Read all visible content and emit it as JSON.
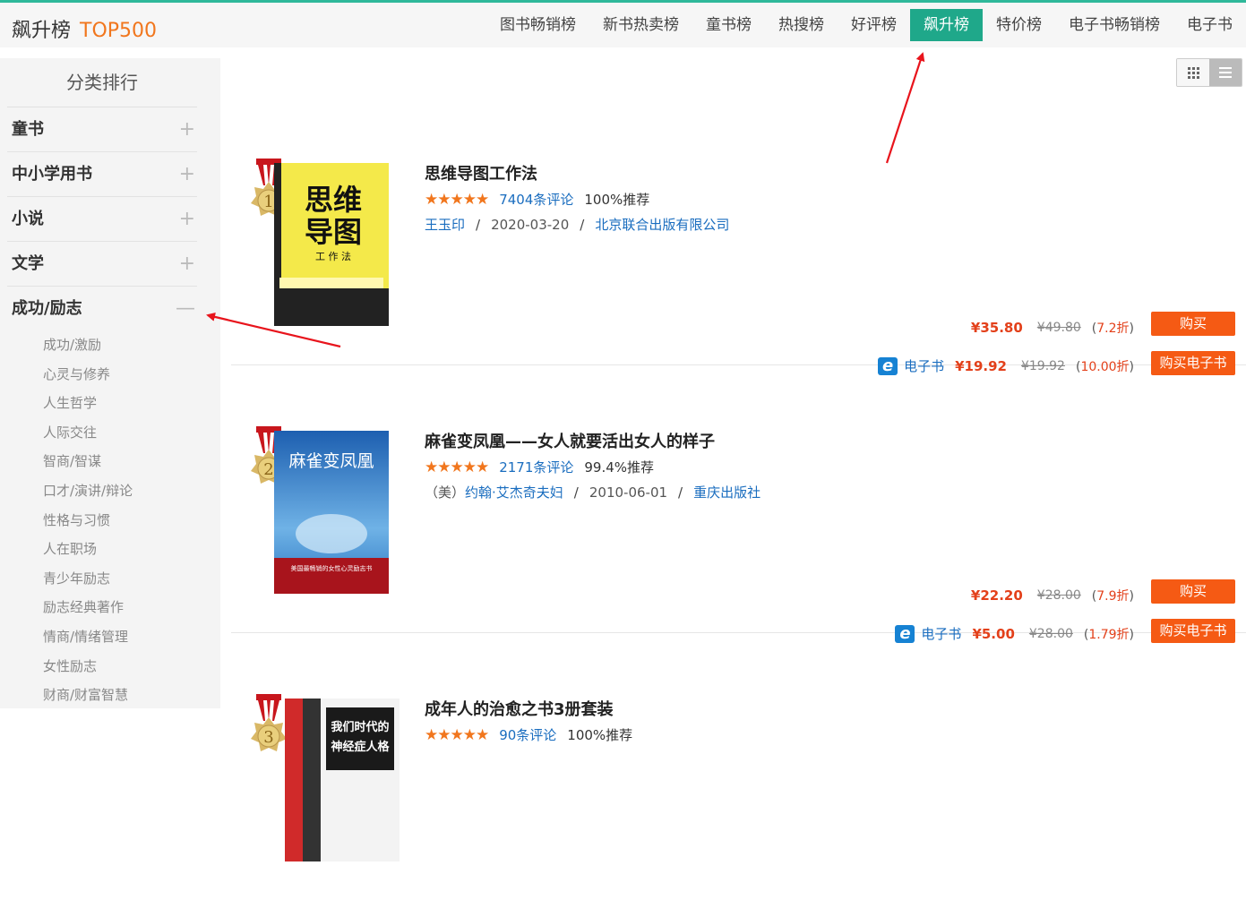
{
  "header": {
    "title": "飙升榜",
    "subtitle": "TOP500",
    "tabs": [
      "图书畅销榜",
      "新书热卖榜",
      "童书榜",
      "热搜榜",
      "好评榜",
      "飙升榜",
      "特价榜",
      "电子书畅销榜",
      "电子书"
    ],
    "active_tab": "飙升榜"
  },
  "sidebar": {
    "title": "分类排行",
    "categories": [
      {
        "label": "童书",
        "sign": "+"
      },
      {
        "label": "中小学用书",
        "sign": "+"
      },
      {
        "label": "小说",
        "sign": "+"
      },
      {
        "label": "文学",
        "sign": "+"
      },
      {
        "label": "成功/励志",
        "sign": "—"
      }
    ],
    "subcategories": [
      "成功/激励",
      "心灵与修养",
      "人生哲学",
      "人际交往",
      "智商/智谋",
      "口才/演讲/辩论",
      "性格与习惯",
      "人在职场",
      "青少年励志",
      "励志经典著作",
      "情商/情绪管理",
      "女性励志",
      "财商/财富智慧"
    ]
  },
  "books": [
    {
      "rank": "1",
      "title": "思维导图工作法",
      "stars": "★★★★★",
      "reviews": "7404条评论",
      "recommend": "100%推荐",
      "author_prefix": "",
      "author": "王玉印",
      "date": "2020-03-20",
      "publisher": "北京联合出版有限公司",
      "price": "¥35.80",
      "orig_price": "¥49.80",
      "discount": "7.2折",
      "ebook_label": "电子书",
      "ebook_price": "¥19.92",
      "ebook_orig": "¥19.92",
      "ebook_discount": "10.00折",
      "cover_title": "思维导图",
      "cover_sub": "工作法"
    },
    {
      "rank": "2",
      "title": "麻雀变凤凰——女人就要活出女人的样子",
      "stars": "★★★★★",
      "reviews": "2171条评论",
      "recommend": "99.4%推荐",
      "author_prefix": "（美）",
      "author": "约翰·艾杰奇夫妇",
      "date": "2010-06-01",
      "publisher": "重庆出版社",
      "price": "¥22.20",
      "orig_price": "¥28.00",
      "discount": "7.9折",
      "ebook_label": "电子书",
      "ebook_price": "¥5.00",
      "ebook_orig": "¥28.00",
      "ebook_discount": "1.79折",
      "cover_title": "麻雀变凤凰",
      "cover_sub": "美国最畅销的女性心灵励志书"
    },
    {
      "rank": "3",
      "title": "成年人的治愈之书3册套装",
      "stars": "★★★★★",
      "reviews": "90条评论",
      "recommend": "100%推荐",
      "cover_title": "我们时代的神经症人格"
    }
  ],
  "buttons": {
    "buy": "购买",
    "buy_ebook": "购买电子书"
  },
  "colors": {
    "accent": "#1fa88a",
    "brand_orange": "#f1761d",
    "buy": "#f55a14",
    "price": "#e3401a",
    "link": "#1a6dbf"
  }
}
